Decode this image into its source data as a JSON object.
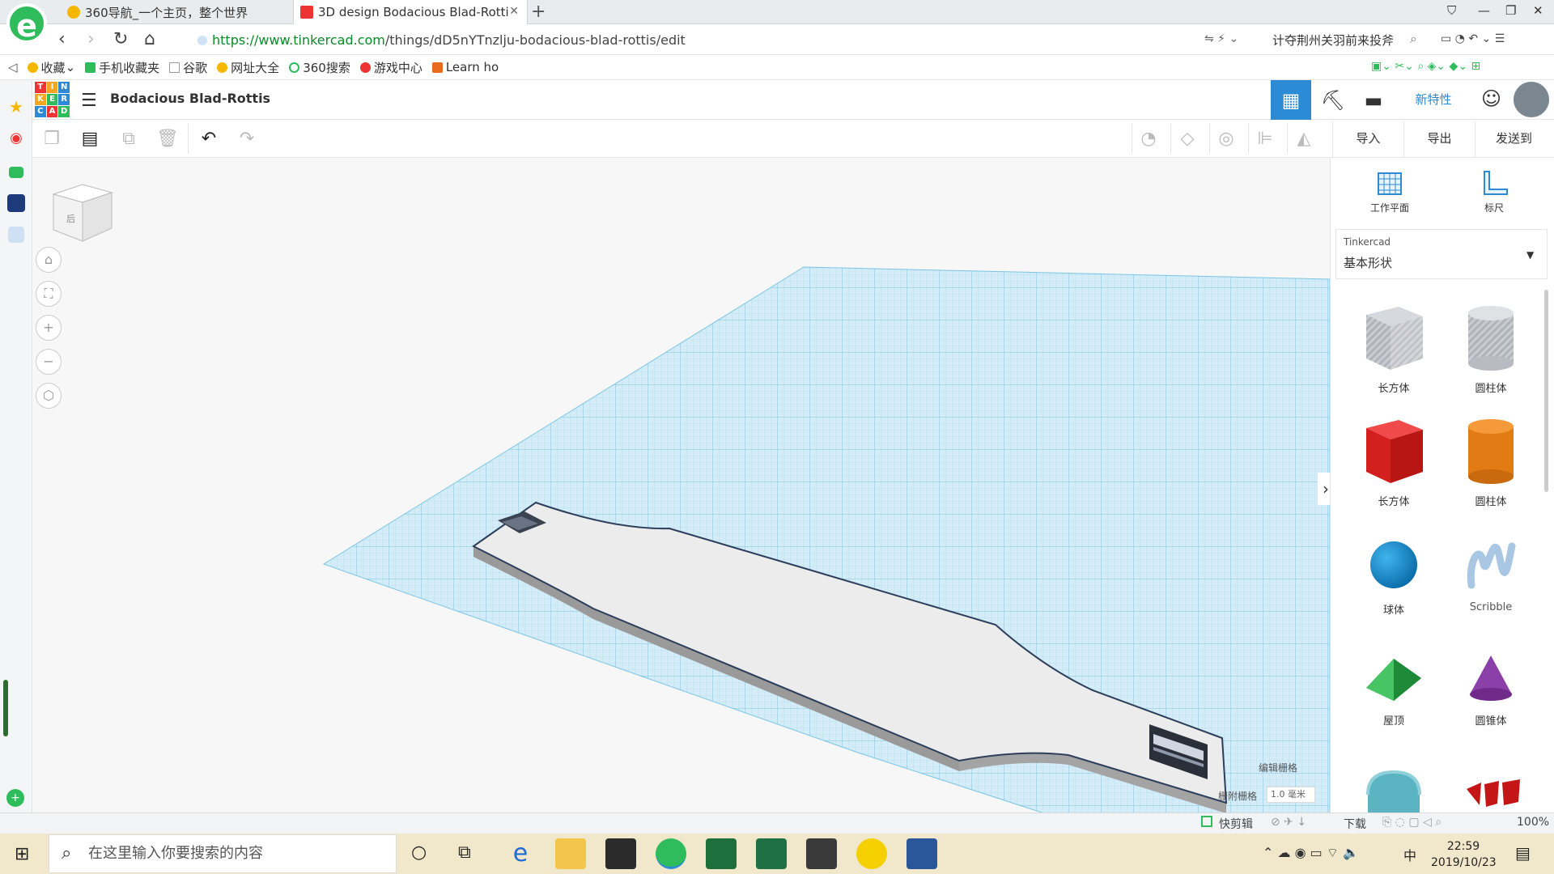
{
  "browser": {
    "logo": "e",
    "tabs": [
      {
        "label": "360导航_一个主页，整个世界"
      },
      {
        "label": "3D design Bodacious Blad-Rotti"
      }
    ],
    "url_host": "https://www.tinkercad.com",
    "url_path": "/things/dD5nYTnzlju-bodacious-blad-rottis/edit",
    "search_hint": "计夺荆州关羽前来投斧",
    "bookmarks": [
      {
        "label": "收藏",
        "color": "#f5b700"
      },
      {
        "label": "手机收藏夹",
        "color": "#2ebc5c"
      },
      {
        "label": "谷歌",
        "color": "#999999"
      },
      {
        "label": "网址大全",
        "color": "#f5b700"
      },
      {
        "label": "360搜索",
        "color": "#2ebc5c"
      },
      {
        "label": "游戏中心",
        "color": "#e33"
      },
      {
        "label": "Learn ho",
        "color": "#e86a1d"
      }
    ]
  },
  "tinkercad": {
    "logo_letters": [
      "T",
      "I",
      "N",
      "K",
      "E",
      "R",
      "C",
      "A",
      "D"
    ],
    "design_title": "Bodacious Blad-Rottis",
    "new_features": "新特性",
    "actions": {
      "import": "导入",
      "export": "导出",
      "send_to": "发送到"
    },
    "workplane_tool": "工作平面",
    "ruler_tool": "标尺",
    "library_source": "Tinkercad",
    "library_name": "基本形状",
    "viewcube_face": "后",
    "grid_edit": "编辑栅格",
    "snap_grid_label": "栅附栅格",
    "snap_grid_value": "1.0 毫米",
    "shapes": [
      {
        "label": "长方体",
        "icon": "box-hole-icon"
      },
      {
        "label": "圆柱体",
        "icon": "cylinder-hole-icon"
      },
      {
        "label": "长方体",
        "icon": "box-icon"
      },
      {
        "label": "圆柱体",
        "icon": "cylinder-icon"
      },
      {
        "label": "球体",
        "icon": "sphere-icon"
      },
      {
        "label": "Scribble",
        "icon": "scribble-icon"
      },
      {
        "label": "屋顶",
        "icon": "roof-icon"
      },
      {
        "label": "圆锥体",
        "icon": "cone-icon"
      }
    ]
  },
  "statusbar": {
    "clip": "快剪辑",
    "download": "下载",
    "zoom": "100%"
  },
  "taskbar": {
    "search_placeholder": "在这里输入你要搜索的内容",
    "ime": "中",
    "time": "22:59",
    "date": "2019/10/23"
  }
}
